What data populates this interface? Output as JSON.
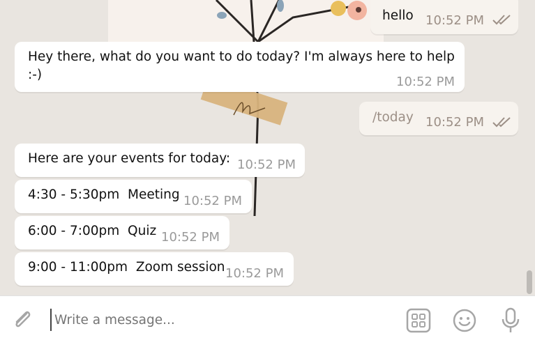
{
  "messages": [
    {
      "direction": "out",
      "text": "hello",
      "time": "10:52 PM",
      "status": "read"
    },
    {
      "direction": "in",
      "text": "Hey there, what do you want to do today? I'm always here to help\n:-)",
      "time": "10:52 PM"
    },
    {
      "direction": "out",
      "text": "/today",
      "time": "10:52 PM",
      "status": "read"
    },
    {
      "direction": "in",
      "text": "Here are your events for today:",
      "time": "10:52 PM"
    },
    {
      "direction": "in",
      "text": "4:30 - 5:30pm  Meeting",
      "time": "10:52 PM"
    },
    {
      "direction": "in",
      "text": "6:00 - 7:00pm  Quiz",
      "time": "10:52 PM"
    },
    {
      "direction": "in",
      "text": "9:00 - 11:00pm  Zoom session",
      "time": "10:52 PM"
    }
  ],
  "composer": {
    "placeholder": "Write a message...",
    "attach_icon": "paperclip-icon",
    "commands_icon": "bot-commands-icon",
    "emoji_icon": "emoji-icon",
    "mic_icon": "microphone-icon"
  },
  "colors": {
    "chat_background": "#e9e5e0",
    "bubble_in": "#ffffff",
    "bubble_out": "#f7f3ee",
    "time_gray": "#9a9a9a",
    "icon_gray": "#a6a6a6"
  }
}
